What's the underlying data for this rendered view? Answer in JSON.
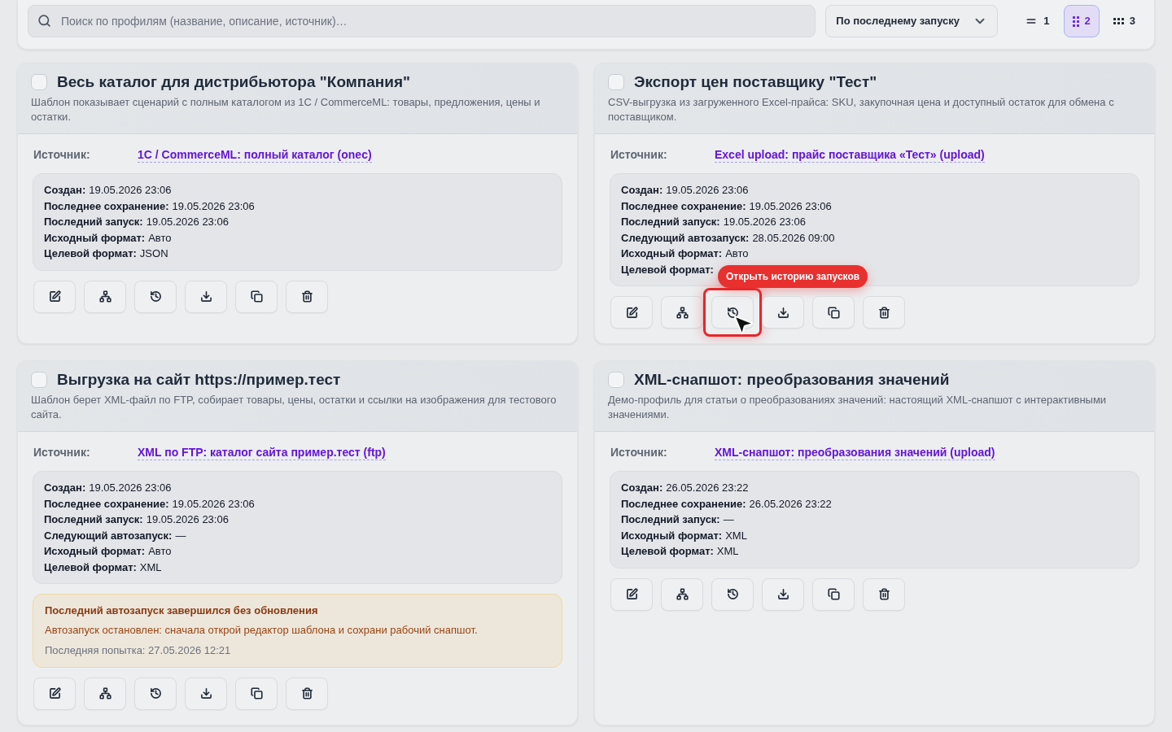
{
  "toolbar": {
    "search": {
      "placeholder": "Поиск по профилям (название, описание, источник)…"
    },
    "sort": {
      "value": "По последнему запуску"
    },
    "views": [
      {
        "kind": "list",
        "label": "1",
        "selected": false
      },
      {
        "kind": "grid2",
        "label": "2",
        "selected": true
      },
      {
        "kind": "grid3",
        "label": "3",
        "selected": false
      }
    ]
  },
  "cards": [
    {
      "checked": false,
      "title": "Весь каталог для дистрибьютора \"Компания\"",
      "description": "Шаблон показывает сценарий с полным каталогом из 1С / CommerceML: товары, предложения, цены и остатки.",
      "source_label": "Источник:",
      "source": "1С / CommerceML: полный каталог (onec)",
      "meta": [
        {
          "term": "Создан:",
          "detail": "19.05.2026 23:06"
        },
        {
          "term": "Последнее сохранение:",
          "detail": "19.05.2026 23:06"
        },
        {
          "term": "Последний запуск:",
          "detail": "19.05.2026 23:06"
        },
        {
          "term": "Исходный формат:",
          "detail": "Авто"
        },
        {
          "term": "Целевой формат:",
          "detail": "JSON"
        }
      ],
      "actions": [
        {
          "kind": "edit",
          "highlighted": false
        },
        {
          "kind": "structure",
          "highlighted": false
        },
        {
          "kind": "history",
          "highlighted": false
        },
        {
          "kind": "download",
          "highlighted": false
        },
        {
          "kind": "copy",
          "highlighted": false
        },
        {
          "kind": "delete",
          "highlighted": false
        }
      ]
    },
    {
      "checked": false,
      "title": "Экспорт цен поставщику \"Тест\"",
      "description": "CSV-выгрузка из загруженного Excel-прайса: SKU, закупочная цена и доступный остаток для обмена с поставщиком.",
      "source_label": "Источник:",
      "source": "Excel upload: прайс поставщика «Тест» (upload)",
      "meta": [
        {
          "term": "Создан:",
          "detail": "19.05.2026 23:06"
        },
        {
          "term": "Последнее сохранение:",
          "detail": "19.05.2026 23:06"
        },
        {
          "term": "Последний запуск:",
          "detail": "19.05.2026 23:06"
        },
        {
          "term": "Следующий автозапуск:",
          "detail": "28.05.2026 09:00"
        },
        {
          "term": "Исходный формат:",
          "detail": "Авто"
        },
        {
          "term": "Целевой формат:"
        }
      ],
      "actions": [
        {
          "kind": "edit",
          "highlighted": false
        },
        {
          "kind": "structure",
          "highlighted": false
        },
        {
          "kind": "history",
          "highlighted": true,
          "tooltip": "Открыть историю запусков"
        },
        {
          "kind": "download",
          "highlighted": false
        },
        {
          "kind": "copy",
          "highlighted": false
        },
        {
          "kind": "delete",
          "highlighted": false
        }
      ]
    },
    {
      "checked": false,
      "title": "Выгрузка на сайт https://пример.тест",
      "description": "Шаблон берет XML-файл по FTP, собирает товары, цены, остатки и ссылки на изображения для тестового сайта.",
      "source_label": "Источник:",
      "source": "XML по FTP: каталог сайта пример.тест (ftp)",
      "meta": [
        {
          "term": "Создан:",
          "detail": "19.05.2026 23:06"
        },
        {
          "term": "Последнее сохранение:",
          "detail": "19.05.2026 23:06"
        },
        {
          "term": "Последний запуск:",
          "detail": "19.05.2026 23:06"
        },
        {
          "term": "Следующий автозапуск:",
          "detail": "—"
        },
        {
          "term": "Исходный формат:",
          "detail": "Авто"
        },
        {
          "term": "Целевой формат:",
          "detail": "XML"
        }
      ],
      "warning": {
        "title": "Последний автозапуск завершился без обновления",
        "message": "Автозапуск остановлен: сначала открой редактор шаблона и сохрани рабочий снапшот.",
        "attempt": "Последняя попытка: 27.05.2026 12:21"
      },
      "actions": [
        {
          "kind": "edit",
          "highlighted": false
        },
        {
          "kind": "structure",
          "highlighted": false
        },
        {
          "kind": "history",
          "highlighted": false
        },
        {
          "kind": "download",
          "highlighted": false
        },
        {
          "kind": "copy",
          "highlighted": false
        },
        {
          "kind": "delete",
          "highlighted": false
        }
      ]
    },
    {
      "checked": false,
      "title": "XML-снапшот: преобразования значений",
      "description": "Демо-профиль для статьи о преобразованиях значений: настоящий XML-снапшот с интерактивными значениями.",
      "source_label": "Источник:",
      "source": "XML-снапшот: преобразования значений (upload)",
      "meta": [
        {
          "term": "Создан:",
          "detail": "26.05.2026 23:22"
        },
        {
          "term": "Последнее сохранение:",
          "detail": "26.05.2026 23:22"
        },
        {
          "term": "Последний запуск:",
          "detail": "—"
        },
        {
          "term": "Исходный формат:",
          "detail": "XML"
        },
        {
          "term": "Целевой формат:",
          "detail": "XML"
        }
      ],
      "actions": [
        {
          "kind": "edit",
          "highlighted": false
        },
        {
          "kind": "structure",
          "highlighted": false
        },
        {
          "kind": "history",
          "highlighted": false
        },
        {
          "kind": "download",
          "highlighted": false
        },
        {
          "kind": "copy",
          "highlighted": false
        },
        {
          "kind": "delete",
          "highlighted": false
        }
      ]
    }
  ]
}
